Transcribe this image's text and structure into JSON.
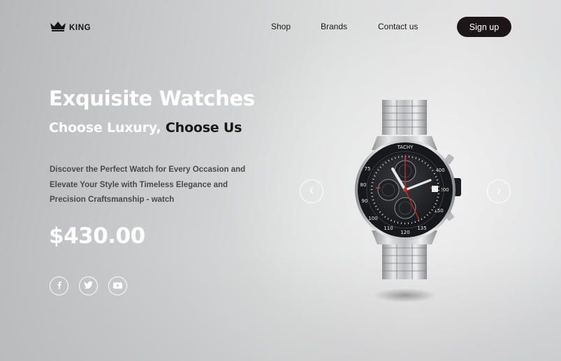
{
  "brand": {
    "name": "KING",
    "icon": "crown-icon"
  },
  "nav": {
    "items": [
      {
        "label": "Shop"
      },
      {
        "label": "Brands"
      },
      {
        "label": "Contact us"
      }
    ],
    "signup_label": "Sign up"
  },
  "hero": {
    "title": "Exquisite Watches",
    "subtitle_light": "Choose Luxury,",
    "subtitle_dark": "Choose Us",
    "description": "Discover the Perfect Watch for Every Occasion and Elevate Your Style with Timeless Elegance and Precision Craftsmanship - watch",
    "price": "$430.00"
  },
  "social": [
    {
      "icon": "facebook-icon"
    },
    {
      "icon": "twitter-icon"
    },
    {
      "icon": "youtube-icon"
    }
  ],
  "carousel": {
    "prev_icon": "chevron-left-icon",
    "next_icon": "chevron-right-icon"
  },
  "colors": {
    "accent_dark": "#1d1618",
    "text_white": "#ffffff",
    "watch_red": "#d12a2a"
  }
}
